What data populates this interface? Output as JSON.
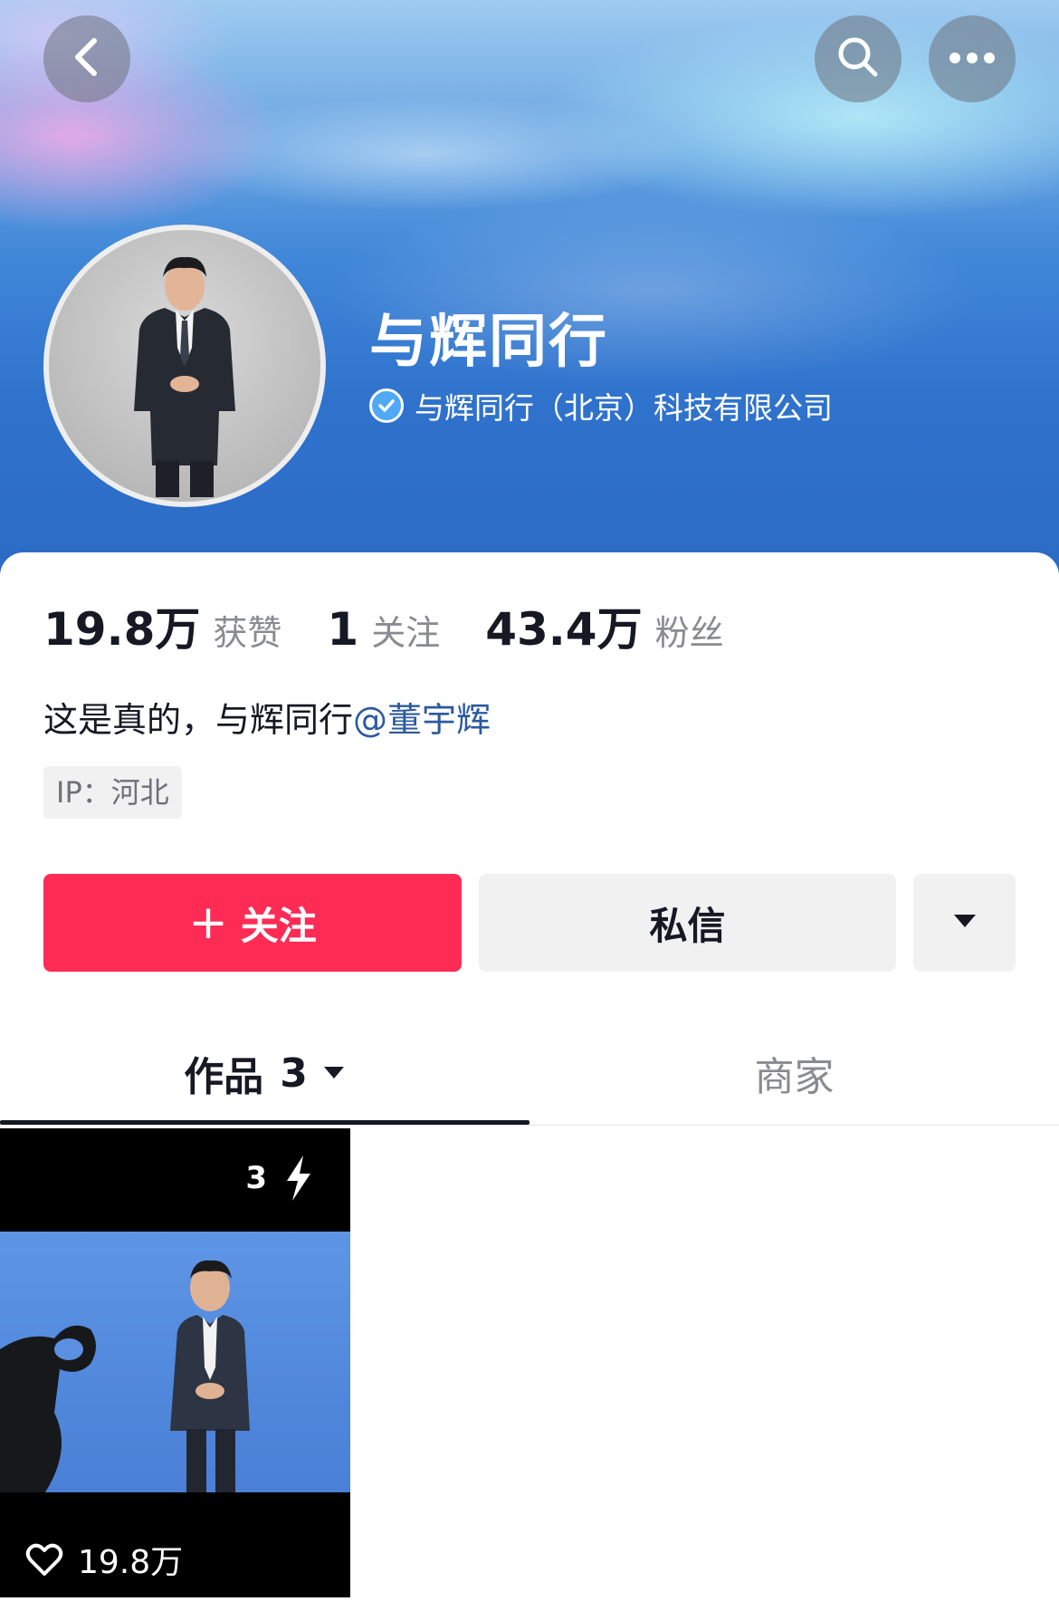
{
  "profile": {
    "name": "与辉同行",
    "verified_label": "与辉同行（北京）科技有限公司",
    "bio_text": "这是真的，与辉同行",
    "bio_mention": "@董宇辉",
    "ip_label": "IP：河北"
  },
  "stats": [
    {
      "value": "19.8万",
      "label": "获赞"
    },
    {
      "value": "1",
      "label": "关注"
    },
    {
      "value": "43.4万",
      "label": "粉丝"
    }
  ],
  "actions": {
    "follow_plus": "+",
    "follow_label": "关注",
    "message_label": "私信"
  },
  "tabs": {
    "works_label": "作品",
    "works_count": "3",
    "shop_label": "商家"
  },
  "videos": [
    {
      "badge_count": "3",
      "likes": "19.8万"
    }
  ],
  "icons": {
    "back": "chevron-left-icon",
    "search": "search-icon",
    "more": "more-dots-icon",
    "verified": "verified-check-icon",
    "dropdown": "triangle-down-icon",
    "bolt": "lightning-icon",
    "heart": "heart-outline-icon"
  },
  "colors": {
    "follow_button": "#fe2c55",
    "secondary_button": "#f1f1f2",
    "mention": "#2c5a9e",
    "verified_badge": "#4fa9f5",
    "muted_text": "#8a8b91"
  }
}
